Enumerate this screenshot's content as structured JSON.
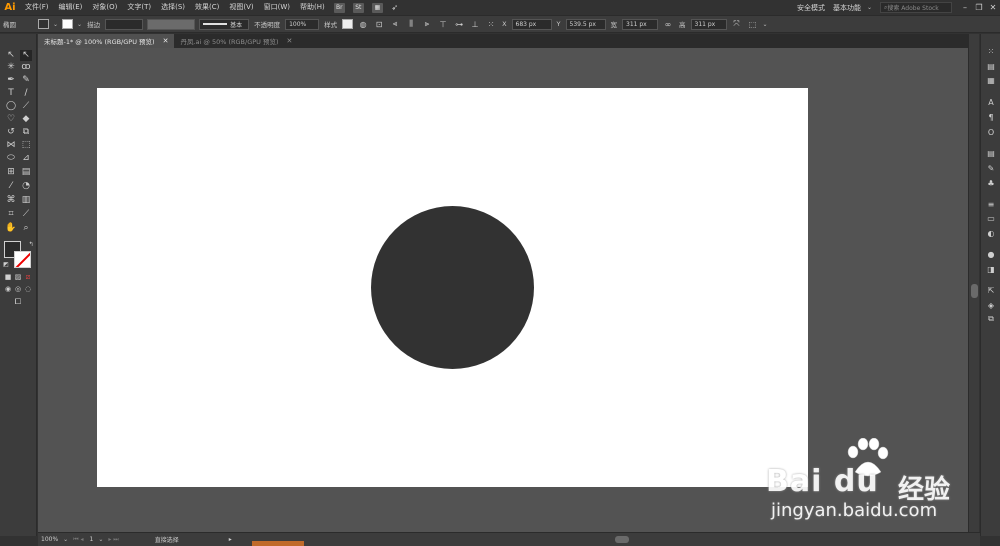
{
  "app": {
    "logo": "Ai"
  },
  "menu": [
    "文件(F)",
    "编辑(E)",
    "对象(O)",
    "文字(T)",
    "选择(S)",
    "效果(C)",
    "视图(V)",
    "窗口(W)",
    "帮助(H)"
  ],
  "menu_icons": {
    "br": "Br",
    "st": "St"
  },
  "menubar_right": {
    "safe_mode": "安全模式",
    "workspace": "基本功能",
    "search_placeholder": "搜索 Adobe Stock"
  },
  "control": {
    "object_label": "椭圆",
    "stroke_label": "描边",
    "stroke_style": "基本",
    "opacity_label": "不透明度",
    "opacity_value": "100%",
    "style_label": "样式",
    "x_label": "X",
    "x_value": "683 px",
    "y_label": "Y",
    "y_value": "539.5 px",
    "w_label": "宽",
    "w_value": "311 px",
    "h_label": "高",
    "h_value": "311 px"
  },
  "tabs": [
    {
      "label": "未标题-1* @ 100% (RGB/GPU 预览)",
      "active": true
    },
    {
      "label": "丹凤.ai @ 50% (RGB/GPU 预览)",
      "active": false
    }
  ],
  "status": {
    "zoom": "100%",
    "artboard": "1",
    "tool_name": "直接选择"
  },
  "colors": {
    "fill": "#323232",
    "artboard": "#ffffff",
    "pasteboard": "#535353",
    "accent": "#ff9a00"
  },
  "watermark": {
    "brand": "Bai du",
    "cn": "经验",
    "url": "jingyan.baidu.com"
  }
}
